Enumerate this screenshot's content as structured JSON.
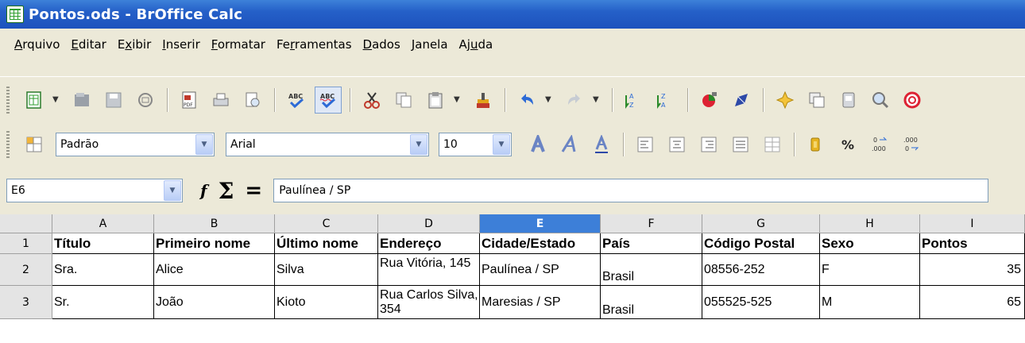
{
  "window": {
    "title": "Pontos.ods - BrOffice Calc",
    "app_icon": "calc-document-icon"
  },
  "menu": [
    {
      "key": "A",
      "rest": "rquivo"
    },
    {
      "key": "E",
      "rest": "ditar"
    },
    {
      "pre": "E",
      "key": "x",
      "rest": "ibir"
    },
    {
      "key": "I",
      "rest": "nserir"
    },
    {
      "key": "F",
      "rest": "ormatar"
    },
    {
      "pre": "Fe",
      "key": "r",
      "rest": "ramentas"
    },
    {
      "key": "D",
      "rest": "ados"
    },
    {
      "key": "J",
      "rest": "anela"
    },
    {
      "pre": "Aj",
      "key": "u",
      "rest": "da"
    }
  ],
  "toolbar2": {
    "style": "Padrão",
    "font": "Arial",
    "size": "10"
  },
  "formula": {
    "cell_ref": "E6",
    "fx_label": "f(x)",
    "sigma": "Σ",
    "equals": "=",
    "content": "Paulínea / SP"
  },
  "grid": {
    "selected_column": "E",
    "columns": [
      "A",
      "B",
      "C",
      "D",
      "E",
      "F",
      "G",
      "H",
      "I"
    ],
    "rows": [
      "1",
      "2",
      "3"
    ],
    "row1": [
      "Título",
      "Primeiro nome",
      "Último nome",
      "Endereço",
      "Cidade/Estado",
      "País",
      "Código Postal",
      "Sexo",
      "Pontos"
    ],
    "row2": [
      "Sra.",
      "Alice",
      "Silva",
      "Rua Vitória, 145",
      "Paulínea / SP",
      "Brasil",
      "08556-252",
      "F",
      "35"
    ],
    "row3": [
      "Sr.",
      "João",
      "Kioto",
      "Rua Carlos Silva, 354",
      "Maresias / SP",
      "Brasil",
      "055525-525",
      "M",
      "65"
    ]
  }
}
